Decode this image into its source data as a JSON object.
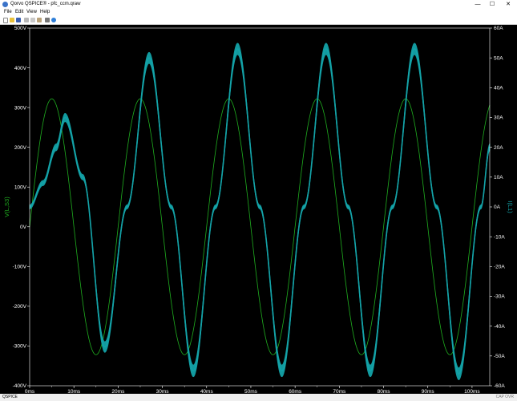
{
  "window": {
    "title": "Qorvo QSPICE® - pfc_ccm.qraw",
    "minimize": "—",
    "maximize": "☐",
    "close": "✕"
  },
  "menu": {
    "items": [
      "File",
      "Edit",
      "View",
      "Help"
    ]
  },
  "toolbar": {
    "buttons": [
      "new-icon",
      "open-icon",
      "save-icon",
      "cut-icon",
      "copy-icon",
      "paste-icon",
      "print-icon",
      "help-icon"
    ]
  },
  "status": {
    "left": "QSPICE",
    "right": "CAP OVR"
  },
  "colors": {
    "voltage_trace": "#1fae1f",
    "current_trace": "#14a3a8",
    "background": "#000000",
    "axis": "#ffffff",
    "left_label": "#1fae1f",
    "right_label": "#14a3a8"
  },
  "chart_data": {
    "type": "line",
    "xlabel": "",
    "ylabel_left": "V(L,S3)",
    "ylabel_right": "I(L1)",
    "x_ticks": [
      "0ms",
      "10ms",
      "20ms",
      "30ms",
      "40ms",
      "50ms",
      "60ms",
      "70ms",
      "80ms",
      "90ms",
      "100ms"
    ],
    "xlim_ms": [
      0,
      104
    ],
    "y_left_ticks": [
      "500V",
      "400V",
      "300V",
      "200V",
      "100V",
      "0V",
      "-100V",
      "-200V",
      "-300V",
      "-400V"
    ],
    "y_left_lim": [
      -400,
      500
    ],
    "y_right_ticks": [
      "60A",
      "50A",
      "40A",
      "30A",
      "20A",
      "10A",
      "0A",
      "-10A",
      "-20A",
      "-30A",
      "-40A",
      "-50A",
      "-60A"
    ],
    "y_right_lim": [
      -60,
      60
    ],
    "grid": false,
    "series": [
      {
        "name": "V(L,S3)",
        "axis": "left",
        "form": "sine",
        "amplitude_V": 322,
        "frequency_Hz": 50,
        "phase_deg": 0,
        "points_ms_V": [
          [
            0,
            0
          ],
          [
            5,
            322
          ],
          [
            10,
            0
          ],
          [
            15,
            -322
          ],
          [
            20,
            0
          ],
          [
            25,
            322
          ],
          [
            30,
            0
          ],
          [
            35,
            -322
          ],
          [
            40,
            0
          ],
          [
            45,
            322
          ],
          [
            50,
            0
          ],
          [
            55,
            -322
          ],
          [
            60,
            0
          ],
          [
            65,
            322
          ],
          [
            70,
            0
          ],
          [
            75,
            -322
          ],
          [
            80,
            0
          ],
          [
            85,
            322
          ],
          [
            90,
            0
          ],
          [
            95,
            -322
          ],
          [
            100,
            0
          ],
          [
            104,
            306
          ]
        ]
      },
      {
        "name": "I(L1)",
        "axis": "right",
        "form": "sine_with_startup",
        "amplitude_A": 52,
        "frequency_Hz": 50,
        "peak_times_ms": [
          8,
          27,
          47,
          67,
          87
        ],
        "peak_values_A": [
          30,
          50,
          53,
          53,
          53
        ],
        "trough_times_ms": [
          17,
          37,
          57,
          77,
          97
        ],
        "trough_values_A": [
          -47,
          -55,
          -55,
          -55,
          -56
        ],
        "ripple_A": 2,
        "points_ms_A": [
          [
            0,
            0
          ],
          [
            3,
            8
          ],
          [
            6,
            20
          ],
          [
            8,
            30
          ],
          [
            12,
            10
          ],
          [
            17,
            -47
          ],
          [
            22,
            0
          ],
          [
            27,
            50
          ],
          [
            32,
            0
          ],
          [
            37,
            -55
          ],
          [
            42,
            0
          ],
          [
            47,
            53
          ],
          [
            52,
            0
          ],
          [
            57,
            -55
          ],
          [
            62,
            0
          ],
          [
            67,
            53
          ],
          [
            72,
            0
          ],
          [
            77,
            -55
          ],
          [
            82,
            0
          ],
          [
            87,
            53
          ],
          [
            92,
            0
          ],
          [
            97,
            -56
          ],
          [
            102,
            0
          ],
          [
            104,
            20
          ]
        ]
      }
    ]
  }
}
